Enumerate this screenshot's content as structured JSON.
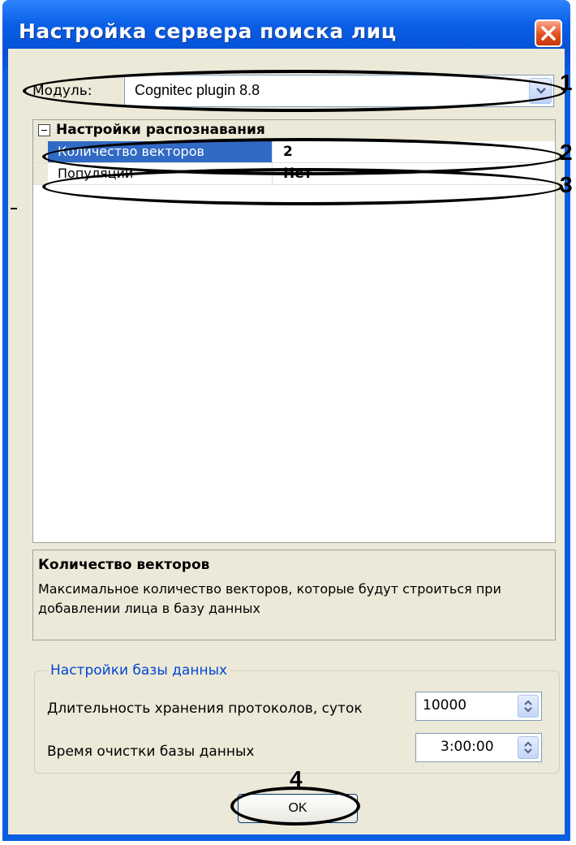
{
  "dialog": {
    "title": "Настройка сервера поиска лиц"
  },
  "module": {
    "label": "Модуль:",
    "value": "Cognitec plugin 8.8"
  },
  "grid": {
    "category": "Настройки распознавания",
    "rows": [
      {
        "name": "Количество векторов",
        "value": "2"
      },
      {
        "name": "Популяции",
        "value": "Нет"
      }
    ]
  },
  "description": {
    "title": "Количество векторов",
    "text": "Максимальное количество векторов, которые будут строиться при добавлении лица в базу данных"
  },
  "database": {
    "group_label": "Настройки базы данных",
    "retention_label": "Длительность хранения протоколов, суток",
    "retention_value": "10000",
    "cleanup_label": "Время очистки базы данных",
    "cleanup_value": "3:00:00"
  },
  "ok_label": "OK",
  "callouts": [
    "1",
    "2",
    "3",
    "4"
  ],
  "colors": {
    "title_bar": "#0a5fe6",
    "selection": "#316ac5",
    "close_button": "#e3501f",
    "dialog_bg": "#ece9d8"
  }
}
